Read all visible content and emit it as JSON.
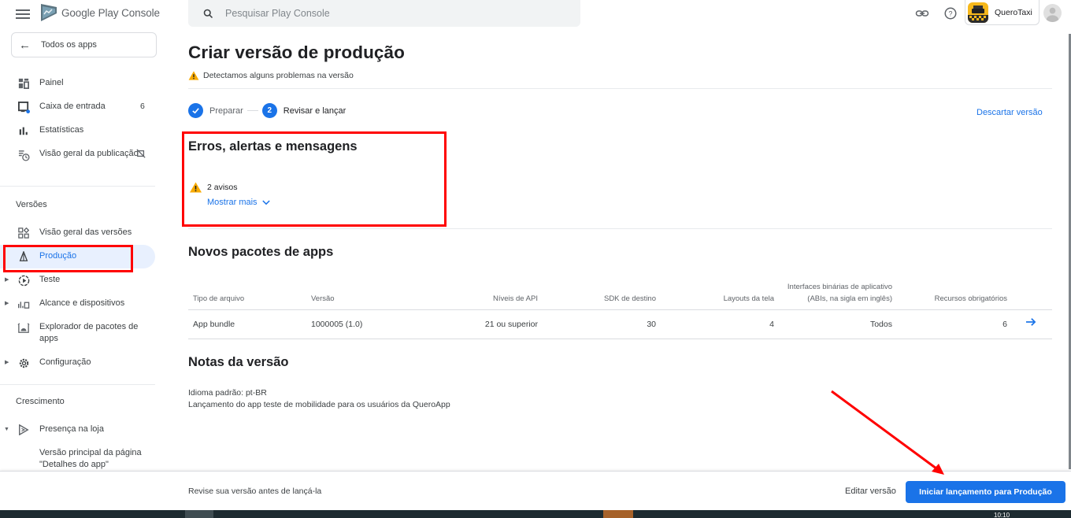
{
  "header": {
    "logo_text_main": "Google Play",
    "logo_text_sub": "Console",
    "search_placeholder": "Pesquisar Play Console",
    "app_name": "QueroTaxi",
    "icons": [
      "menu-icon",
      "link-icon",
      "help-icon",
      "app-icon",
      "account-avatar-icon"
    ]
  },
  "sidebar": {
    "back_label": "Todos os apps",
    "items": [
      {
        "label": "Painel",
        "icon": "dashboard-icon"
      },
      {
        "label": "Caixa de entrada",
        "icon": "inbox-icon",
        "badge": "6"
      },
      {
        "label": "Estatísticas",
        "icon": "bar-chart-icon"
      },
      {
        "label": "Visão geral da publicação",
        "icon": "publishing-overview-icon",
        "trailing_icon": "managed-publishing-off-icon"
      }
    ],
    "sections": [
      {
        "title": "Versões",
        "items": [
          {
            "label": "Visão geral das versões",
            "icon": "releases-overview-icon"
          },
          {
            "label": "Produção",
            "icon": "production-icon",
            "active": true
          },
          {
            "label": "Teste",
            "icon": "testing-icon",
            "expandable": true
          },
          {
            "label": "Alcance e dispositivos",
            "icon": "reach-devices-icon",
            "expandable": true
          },
          {
            "label": "Explorador de pacotes de apps",
            "icon": "bundle-explorer-icon"
          },
          {
            "label": "Configuração",
            "icon": "gear-icon",
            "expandable": true
          }
        ]
      },
      {
        "title": "Crescimento",
        "items": [
          {
            "label": "Presença na loja",
            "icon": "store-presence-icon",
            "expanded": true
          },
          {
            "label": "Versão principal da página \"Detalhes do app\"",
            "sub": true
          }
        ]
      }
    ]
  },
  "main": {
    "title": "Criar versão de produção",
    "warning_banner": "Detectamos alguns problemas na versão",
    "steps": [
      {
        "label": "Preparar",
        "state": "done"
      },
      {
        "label": "Revisar e lançar",
        "number": "2",
        "state": "current"
      }
    ],
    "discard_label": "Descartar versão",
    "errors_section": {
      "title": "Erros, alertas e mensagens",
      "warnings_text": "2 avisos",
      "show_more_label": "Mostrar mais"
    },
    "bundles_section": {
      "title": "Novos pacotes de apps",
      "columns": [
        "Tipo de arquivo",
        "Versão",
        "Níveis de API",
        "SDK de destino",
        "Layouts da tela",
        "Interfaces binárias de aplicativo",
        "(ABIs, na sigla em inglês)",
        "Recursos obrigatórios"
      ],
      "rows": [
        {
          "file_type": "App bundle",
          "version": "1000005 (1.0)",
          "api_levels": "21 ou superior",
          "target_sdk": "30",
          "screen_layouts": "4",
          "abis": "Todos",
          "required_features": "6"
        }
      ]
    },
    "notes_section": {
      "title": "Notas da versão",
      "default_language": "Idioma padrão: pt-BR",
      "text": "Lançamento do app teste de mobilidade para os usuários da QueroApp"
    }
  },
  "footer": {
    "message": "Revise sua versão antes de lançá-la",
    "edit_label": "Editar versão",
    "primary_label": "Iniciar lançamento para Produção"
  },
  "taskbar": {
    "clock": "10:10"
  },
  "colors": {
    "accent": "#1a73e8",
    "annotation_red": "#ff0000",
    "warning": "#f9ab00",
    "active_bg": "#e8f0fe"
  }
}
